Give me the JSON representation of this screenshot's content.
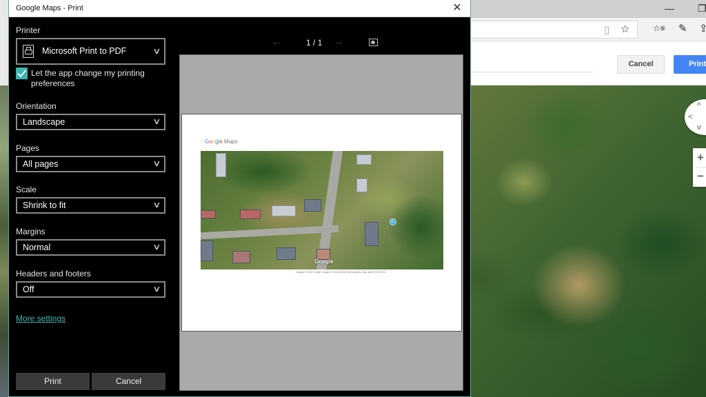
{
  "dialog": {
    "title": "Google Maps - Print",
    "close_icon": "✕",
    "settings": {
      "printer": {
        "label": "Printer",
        "value": "Microsoft Print to PDF",
        "icon": "printer-icon"
      },
      "app_prefs": {
        "label": "Let the app change my printing preferences",
        "checked": true
      },
      "orientation": {
        "label": "Orientation",
        "value": "Landscape"
      },
      "pages": {
        "label": "Pages",
        "value": "All pages"
      },
      "scale": {
        "label": "Scale",
        "value": "Shrink to fit"
      },
      "margins": {
        "label": "Margins",
        "value": "Normal"
      },
      "headers_footers": {
        "label": "Headers and footers",
        "value": "Off"
      },
      "more_settings": "More settings"
    },
    "buttons": {
      "print": "Print",
      "cancel": "Cancel"
    },
    "preview": {
      "prev_icon": "←",
      "next_icon": "→",
      "page_indicator": "1 / 1",
      "page": {
        "logo": {
          "g1": "G",
          "g2": "o",
          "g3": "o",
          "g4": "g",
          "g5": "l",
          "g6": "e",
          "rest": " Maps"
        },
        "watermark": "Google",
        "credit": "Imagery ©2018 Google, Imagery ©2018 Maxar Technologies, Map data ©2018    20 ft"
      }
    }
  },
  "browser": {
    "window_controls": {
      "minimize": "—",
      "restore": "❐"
    },
    "toolbar_icons": {
      "reading": "▯",
      "favorite": "☆",
      "favorites_list": "☆≡",
      "notes": "✎",
      "share": "⇪"
    },
    "page_buttons": {
      "cancel": "Cancel",
      "print": "Print"
    },
    "map_controls": {
      "up": "^",
      "left": "<",
      "down": "v",
      "zoom_in": "+",
      "zoom_out": "−"
    }
  },
  "colors": {
    "accent": "#3bb5b0",
    "link": "#45b8b3",
    "gm_print": "#4285f4"
  }
}
